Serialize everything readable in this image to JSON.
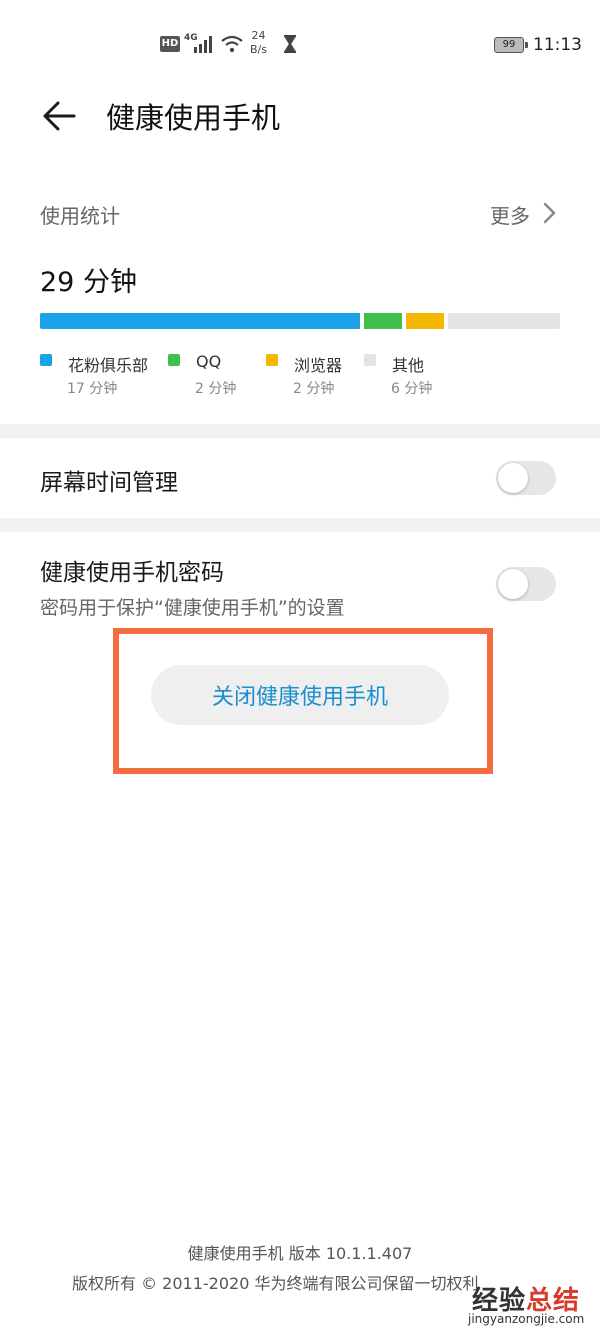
{
  "status_bar": {
    "hd": "HD",
    "network": "4G",
    "speed_value": "24",
    "speed_unit": "B/s",
    "battery": "99",
    "time": "11:13"
  },
  "header": {
    "title": "健康使用手机"
  },
  "usage": {
    "label": "使用统计",
    "more": "更多",
    "total": "29 分钟",
    "apps": [
      {
        "name": "花粉俱乐部",
        "time": "17 分钟",
        "minutes": 17,
        "color": "#1aa3e8"
      },
      {
        "name": "QQ",
        "time": "2 分钟",
        "minutes": 2,
        "color": "#3fc04a"
      },
      {
        "name": "浏览器",
        "time": "2 分钟",
        "minutes": 2,
        "color": "#f5b800"
      },
      {
        "name": "其他",
        "time": "6 分钟",
        "minutes": 6,
        "color": "#e4e4e4"
      }
    ]
  },
  "settings": {
    "screen_time": {
      "label": "屏幕时间管理",
      "enabled": false
    },
    "password": {
      "label": "健康使用手机密码",
      "sub": "密码用于保护“健康使用手机”的设置",
      "enabled": false
    }
  },
  "close_button": "关闭健康使用手机",
  "footer": {
    "version": "健康使用手机 版本 10.1.1.407",
    "copyright": "版权所有 © 2011-2020 华为终端有限公司保留一切权利"
  },
  "watermark": {
    "text_main": "经验",
    "text_accent": "总结",
    "url": "jingyanzongjie.com"
  },
  "colors": {
    "highlight": "#f36c42",
    "button_text": "#1a8fce"
  }
}
